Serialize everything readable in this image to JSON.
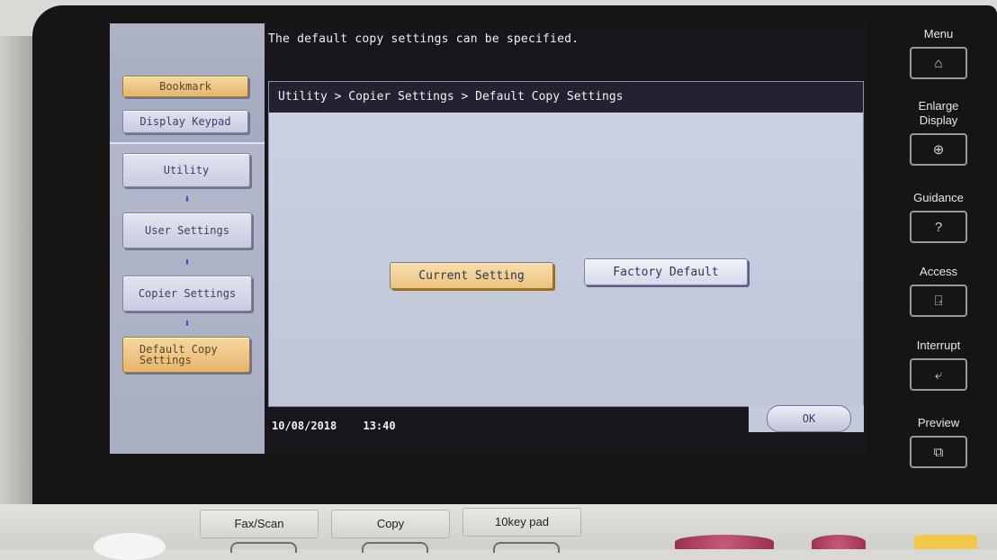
{
  "header": {
    "message": "The default copy settings can be specified."
  },
  "sidebar": {
    "bookmark_label": "Bookmark",
    "display_keypad_label": "Display Keypad",
    "path": [
      {
        "label": "Utility"
      },
      {
        "label": "User Settings"
      },
      {
        "label": "Copier Settings"
      },
      {
        "label": "Default Copy Settings"
      }
    ],
    "arrow_glyph": "⬇"
  },
  "main": {
    "breadcrumb": "Utility > Copier Settings > Default Copy Settings",
    "options": {
      "current_setting": "Current Setting",
      "factory_default": "Factory Default"
    },
    "selected_option": "current_setting"
  },
  "footer": {
    "date": "10/08/2018",
    "time": "13:40",
    "ok_label": "OK"
  },
  "hardware_keys": [
    {
      "label": "Menu",
      "icon": "home-icon",
      "glyph": "⌂"
    },
    {
      "label": "Enlarge Display",
      "icon": "magnify-plus-icon",
      "glyph": "⊕"
    },
    {
      "label": "Guidance",
      "icon": "question-icon",
      "glyph": "?"
    },
    {
      "label": "Access",
      "icon": "access-icon",
      "glyph": "⍈"
    },
    {
      "label": "Interrupt",
      "icon": "interrupt-icon",
      "glyph": "⤶"
    },
    {
      "label": "Preview",
      "icon": "preview-icon",
      "glyph": "⧉"
    }
  ],
  "bottom_tabs": {
    "fax_scan": "Fax/Scan",
    "copy": "Copy",
    "tenkey": "10key pad"
  },
  "colors": {
    "selected_button": "#ecc27c",
    "panel_bg": "#c4cadb",
    "header_bar": "#222230",
    "arrow": "#2549b8"
  }
}
